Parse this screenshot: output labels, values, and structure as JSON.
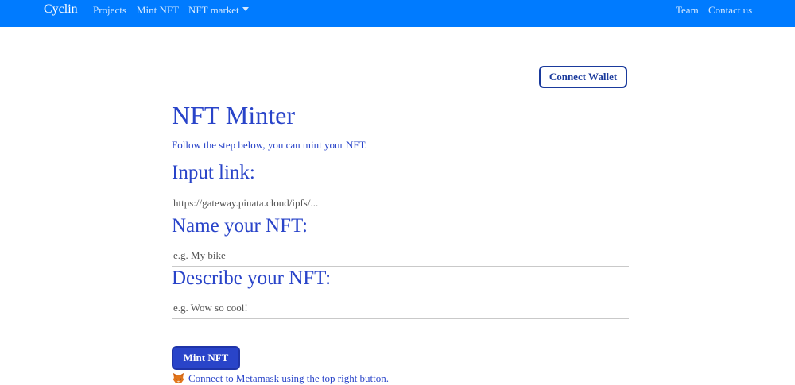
{
  "navbar": {
    "brand": "Cyclin",
    "links": {
      "projects": "Projects",
      "mint_nft": "Mint NFT",
      "nft_market": "NFT market",
      "team": "Team",
      "contact_us": "Contact us"
    },
    "background_color": "#007bff"
  },
  "wallet": {
    "connect_label": "Connect Wallet"
  },
  "main": {
    "title": "NFT Minter",
    "subtitle": "Follow the step below, you can mint your NFT.",
    "fields": {
      "link": {
        "label": "Input link:",
        "placeholder": "https://gateway.pinata.cloud/ipfs/...",
        "value": ""
      },
      "name": {
        "label": "Name your NFT:",
        "placeholder": "e.g. My bike",
        "value": ""
      },
      "description": {
        "label": "Describe your NFT:",
        "placeholder": "e.g. Wow so cool!",
        "value": ""
      }
    },
    "mint_label": "Mint NFT",
    "status": {
      "icon": "metamask-fox-icon",
      "text": "Connect to Metamask using the top right button."
    }
  },
  "colors": {
    "accent": "#2944c9",
    "button_border": "#1a3a9c"
  }
}
